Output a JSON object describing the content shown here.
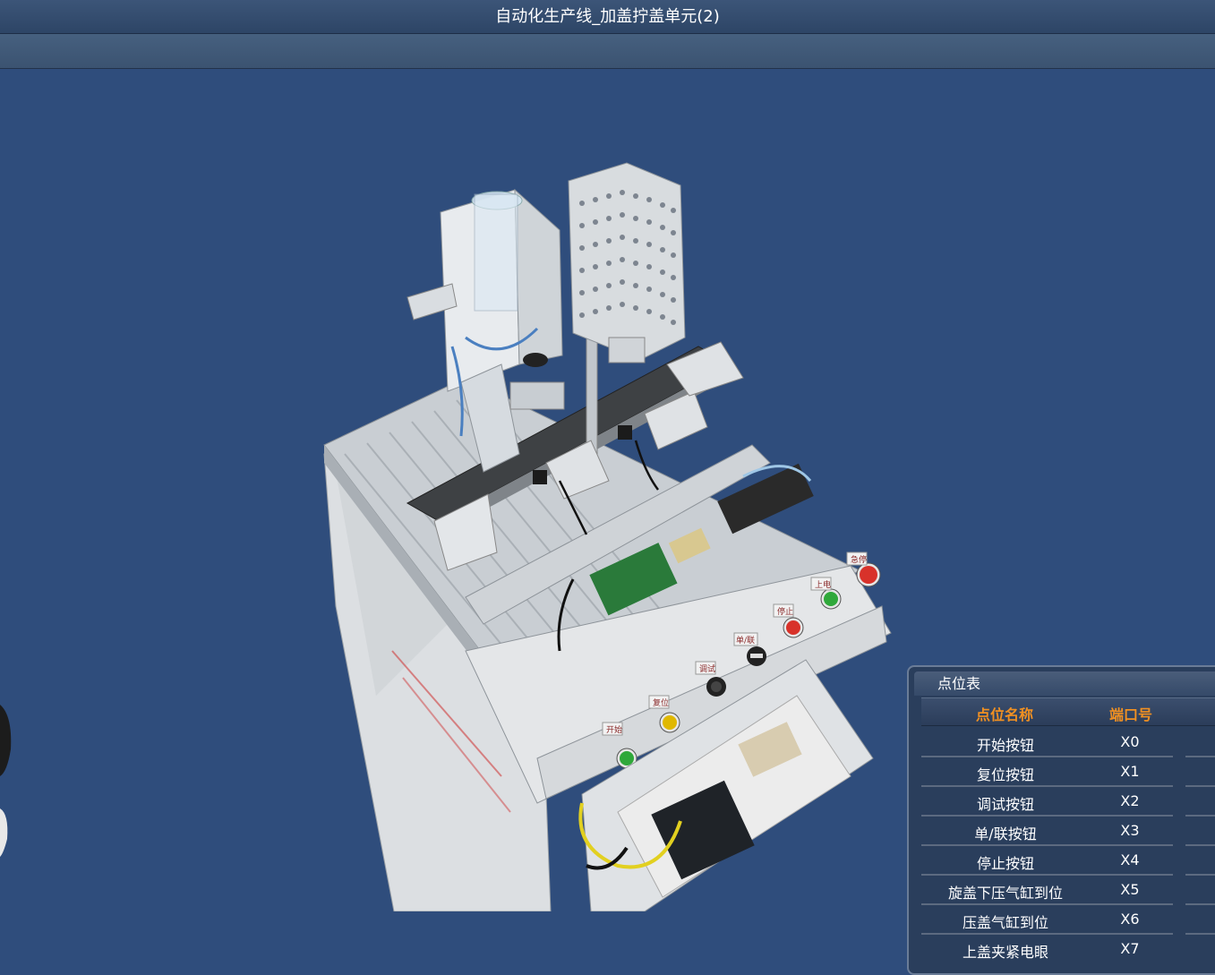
{
  "window": {
    "title": "自动化生产线_加盖拧盖单元(2)"
  },
  "scene": {
    "panel_labels": [
      "开始",
      "复位",
      "调试",
      "单/联",
      "停止",
      "上电",
      "急停"
    ]
  },
  "point_table": {
    "title": "点位表",
    "headers": {
      "name": "点位名称",
      "port": "端口号"
    },
    "rows": [
      {
        "name": "开始按钮",
        "port": "X0"
      },
      {
        "name": "复位按钮",
        "port": "X1"
      },
      {
        "name": "调试按钮",
        "port": "X2"
      },
      {
        "name": "单/联按钮",
        "port": "X3"
      },
      {
        "name": "停止按钮",
        "port": "X4"
      },
      {
        "name": "旋盖下压气缸到位",
        "port": "X5"
      },
      {
        "name": "压盖气缸到位",
        "port": "X6"
      },
      {
        "name": "上盖夹紧电眼",
        "port": "X7"
      }
    ]
  },
  "colors": {
    "background": "#2f4d7c",
    "header_accent": "#f09022",
    "button_green": "#2fa83a",
    "button_yellow": "#e0b800",
    "button_red": "#d8322a"
  }
}
